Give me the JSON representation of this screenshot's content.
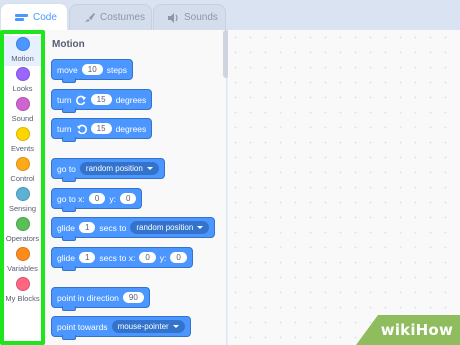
{
  "tabs": [
    {
      "label": "Code",
      "icon": "code-icon"
    },
    {
      "label": "Costumes",
      "icon": "costume-brush-icon"
    },
    {
      "label": "Sounds",
      "icon": "speaker-icon"
    }
  ],
  "categories": [
    {
      "label": "Motion",
      "color": "#4c97ff"
    },
    {
      "label": "Looks",
      "color": "#9966ff"
    },
    {
      "label": "Sound",
      "color": "#cf63cf"
    },
    {
      "label": "Events",
      "color": "#ffd500"
    },
    {
      "label": "Control",
      "color": "#ffab19"
    },
    {
      "label": "Sensing",
      "color": "#5cb1d6"
    },
    {
      "label": "Operators",
      "color": "#59c059"
    },
    {
      "label": "Variables",
      "color": "#ff8c1a"
    },
    {
      "label": "My Blocks",
      "color": "#ff6680"
    }
  ],
  "palette": {
    "title": "Motion",
    "move": {
      "pre": "move",
      "value": "10",
      "post": "steps"
    },
    "turn_right": {
      "pre": "turn",
      "value": "15",
      "post": "degrees"
    },
    "turn_left": {
      "pre": "turn",
      "value": "15",
      "post": "degrees"
    },
    "goto": {
      "pre": "go to",
      "option": "random position"
    },
    "goto_xy": {
      "pre": "go to x:",
      "x": "0",
      "ylabel": "y:",
      "y": "0"
    },
    "glide": {
      "pre": "glide",
      "value": "1",
      "mid": "secs to",
      "option": "random position"
    },
    "glide_xy": {
      "pre": "glide",
      "value": "1",
      "mid": "secs to x:",
      "x": "0",
      "ylabel": "y:",
      "y": "0"
    },
    "point_dir": {
      "pre": "point in direction",
      "value": "90"
    },
    "point_towards": {
      "pre": "point towards",
      "option": "mouse-pointer"
    }
  },
  "watermark": {
    "text": "wikiHow"
  },
  "colors": {
    "motion": "#4c97ff",
    "highlight": "#1ee61c"
  }
}
